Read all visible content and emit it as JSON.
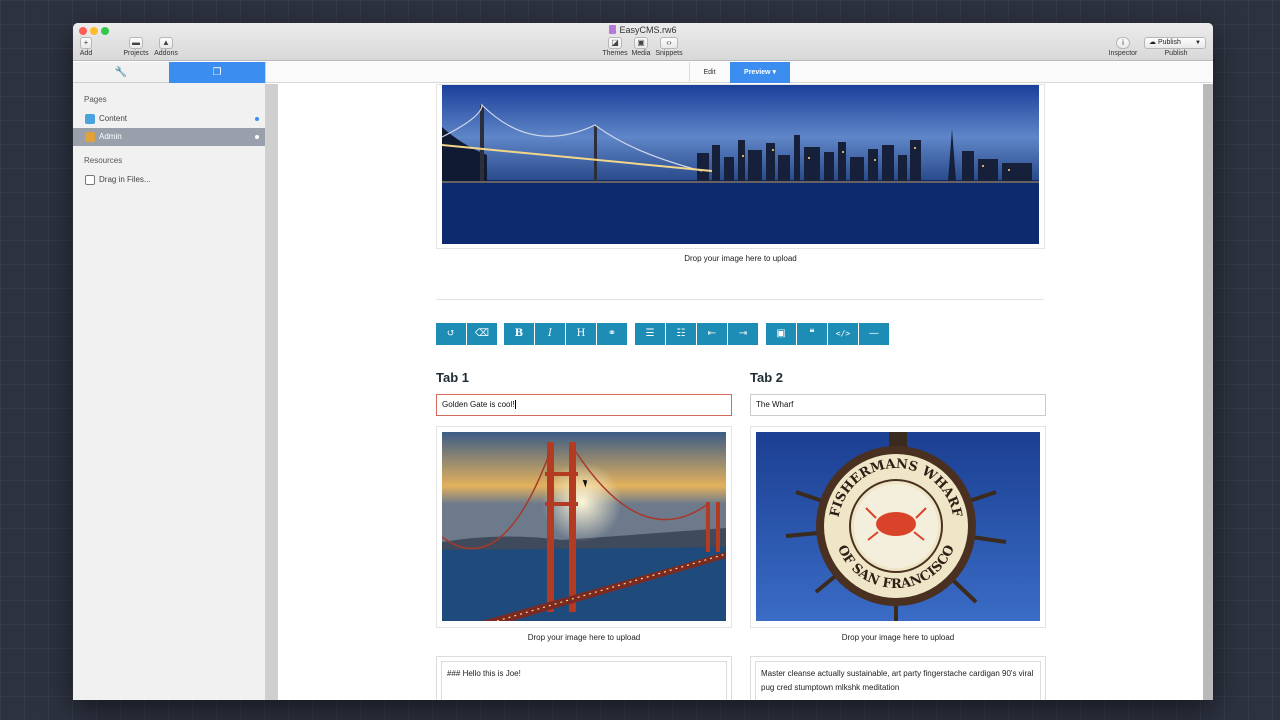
{
  "window": {
    "title": "EasyCMS.rw6",
    "toolbar": {
      "add_label": "Add",
      "projects_label": "Projects",
      "addons_label": "Addons",
      "themes_label": "Themes",
      "media_label": "Media",
      "snippets_label": "Snippets",
      "inspector_label": "Inspector",
      "publish_button": "Publish",
      "publish_label": "Publish"
    }
  },
  "sidebar": {
    "pages_heading": "Pages",
    "pages": [
      {
        "label": "Content",
        "icon": "page-icon",
        "color": "#4aa3df"
      },
      {
        "label": "Admin",
        "icon": "admin-icon",
        "color": "#e0a23a",
        "selected": true
      }
    ],
    "resources_heading": "Resources",
    "resources": [
      {
        "label": "Drag in Files...",
        "icon": "drag-files-icon"
      }
    ]
  },
  "editbar": {
    "edit_label": "Edit",
    "preview_label": "Preview"
  },
  "content": {
    "hero_caption": "Drop your image here to upload",
    "toolbar_icons": [
      "undo-icon",
      "eraser-icon",
      "bold-icon",
      "italic-icon",
      "heading-icon",
      "link-icon",
      "bullet-list-icon",
      "numbered-list-icon",
      "outdent-icon",
      "indent-icon",
      "image-icon",
      "quote-icon",
      "code-icon",
      "horizontal-rule-icon"
    ],
    "toolbar_labels": {
      "undo": "↺",
      "eraser": "⌫",
      "bold": "B",
      "italic": "I",
      "heading": "H",
      "link": "⚭",
      "bullets": "☰",
      "numbers": "☷",
      "outdent": "⇤",
      "indent": "⇥",
      "image": "▣",
      "quote": "❝",
      "code": "</>",
      "hr": "—"
    },
    "tab1": {
      "title": "Tab 1",
      "input_value": "Golden Gate is cool!",
      "image_caption": "Drop your image here to upload",
      "textarea_text": "### Hello this is Joe!"
    },
    "tab2": {
      "title": "Tab 2",
      "input_value": "The Wharf",
      "image_caption": "Drop your image here to upload",
      "sign_top": "FISHERMANS WHARF",
      "sign_bottom": "OF SAN FRANCISCO",
      "textarea_text": "Master cleanse actually sustainable, art party fingerstache cardigan 90's viral pug cred stumptown mlkshk meditation"
    }
  },
  "colors": {
    "accent": "#3b8ef0",
    "toolbar": "#1e8db5",
    "focus_border": "#d26b5a"
  }
}
